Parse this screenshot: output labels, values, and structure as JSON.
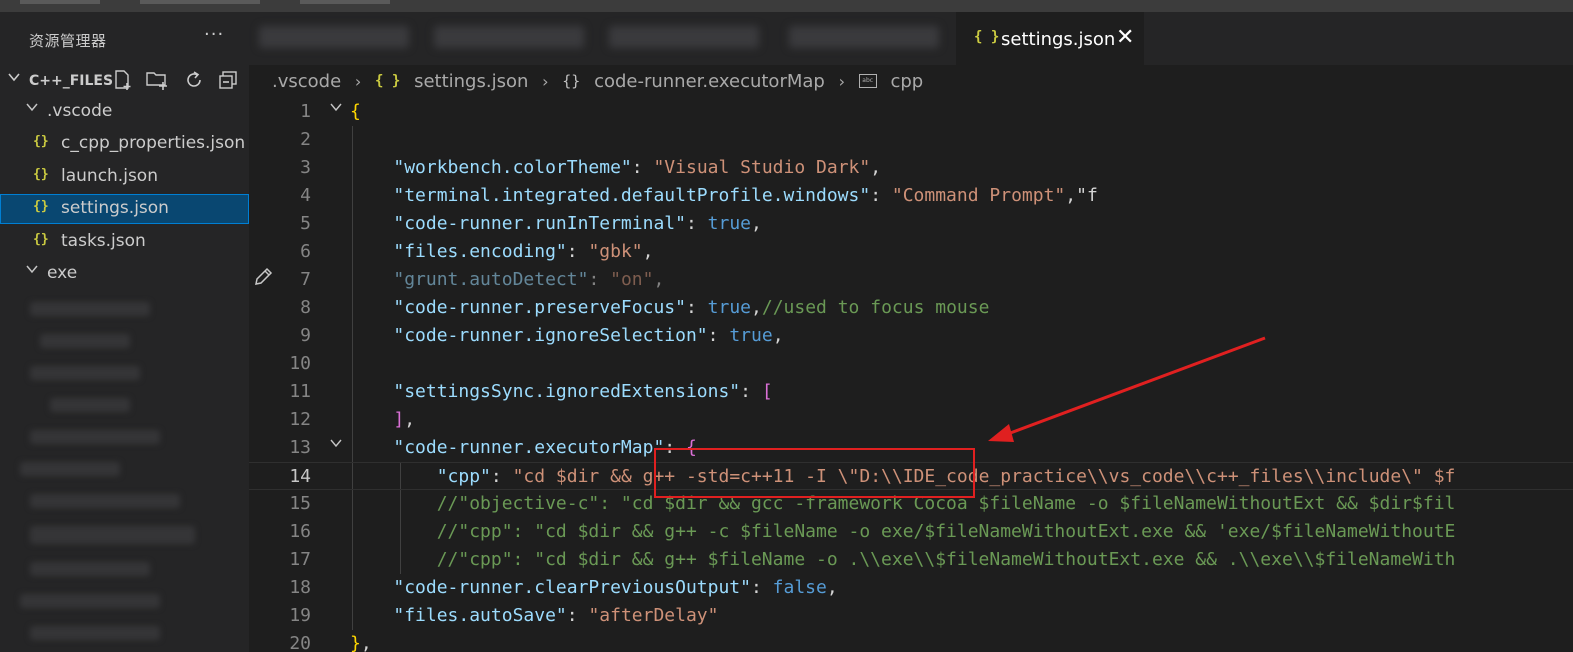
{
  "sidebar": {
    "title": "资源管理器",
    "more": "···",
    "folder_name": "C++_FILES",
    "items": [
      {
        "label": ".vscode",
        "kind": "folder"
      },
      {
        "label": "c_cpp_properties.json",
        "kind": "json"
      },
      {
        "label": "launch.json",
        "kind": "json"
      },
      {
        "label": "settings.json",
        "kind": "json",
        "selected": true
      },
      {
        "label": "tasks.json",
        "kind": "json"
      },
      {
        "label": "exe",
        "kind": "folder"
      }
    ]
  },
  "tab": {
    "icon": "{ }",
    "label": "settings.json",
    "close": "✕"
  },
  "breadcrumb": {
    "items": [
      ".vscode",
      "settings.json",
      "code-runner.executorMap",
      "cpp"
    ],
    "json_icon": "{ }",
    "obj_icon": "{}",
    "sep": "›"
  },
  "editor": {
    "line_numbers": [
      "1",
      "2",
      "3",
      "4",
      "5",
      "6",
      "7",
      "8",
      "9",
      "10",
      "11",
      "12",
      "13",
      "14",
      "15",
      "16",
      "17",
      "18",
      "19",
      "20"
    ],
    "lines": [
      [
        [
          "y",
          "{"
        ]
      ],
      [],
      [
        [
          "p",
          "    "
        ],
        [
          "k",
          "\"workbench.colorTheme\""
        ],
        [
          "p",
          ": "
        ],
        [
          "s",
          "\"Visual Studio Dark\""
        ],
        [
          "p",
          ","
        ]
      ],
      [
        [
          "p",
          "    "
        ],
        [
          "k",
          "\"terminal.integrated.defaultProfile.windows\""
        ],
        [
          "p",
          ": "
        ],
        [
          "s",
          "\"Command Prompt\""
        ],
        [
          "p",
          ",\"f"
        ]
      ],
      [
        [
          "p",
          "    "
        ],
        [
          "k",
          "\"code-runner.runInTerminal\""
        ],
        [
          "p",
          ": "
        ],
        [
          "b",
          "true"
        ],
        [
          "p",
          ","
        ]
      ],
      [
        [
          "p",
          "    "
        ],
        [
          "k",
          "\"files.encoding\""
        ],
        [
          "p",
          ": "
        ],
        [
          "s",
          "\"gbk\""
        ],
        [
          "p",
          ","
        ]
      ],
      [
        [
          "p",
          "    "
        ],
        [
          "k",
          "\"grunt.autoDetect\""
        ],
        [
          "p",
          ": "
        ],
        [
          "s",
          "\"on\""
        ],
        [
          "p",
          ","
        ]
      ],
      [
        [
          "p",
          "    "
        ],
        [
          "k",
          "\"code-runner.preserveFocus\""
        ],
        [
          "p",
          ": "
        ],
        [
          "b",
          "true"
        ],
        [
          "p",
          ","
        ],
        [
          "c",
          "//used to focus mouse"
        ]
      ],
      [
        [
          "p",
          "    "
        ],
        [
          "k",
          "\"code-runner.ignoreSelection\""
        ],
        [
          "p",
          ": "
        ],
        [
          "b",
          "true"
        ],
        [
          "p",
          ","
        ]
      ],
      [],
      [
        [
          "p",
          "    "
        ],
        [
          "k",
          "\"settingsSync.ignoredExtensions\""
        ],
        [
          "p",
          ": "
        ],
        [
          "m",
          "["
        ]
      ],
      [
        [
          "p",
          "    "
        ],
        [
          "m",
          "]"
        ],
        [
          "p",
          ","
        ]
      ],
      [
        [
          "p",
          "    "
        ],
        [
          "k",
          "\"code-runner.executorMap\""
        ],
        [
          "p",
          ": "
        ],
        [
          "m",
          "{"
        ]
      ],
      [
        [
          "p",
          "        "
        ],
        [
          "k",
          "\"cpp\""
        ],
        [
          "p",
          ": "
        ],
        [
          "s",
          "\"cd $dir && g++ -std=c++11 -I \\\"D:\\\\IDE_code_practice\\\\vs_code\\\\c++_files\\\\include\\\" $f"
        ]
      ],
      [
        [
          "p",
          "        "
        ],
        [
          "c",
          "//\"objective-c\": \"cd $dir && gcc -framework Cocoa $fileName -o $fileNameWithoutExt && $dir$fil"
        ]
      ],
      [
        [
          "p",
          "        "
        ],
        [
          "c",
          "//\"cpp\": \"cd $dir && g++ -c $fileName -o exe/$fileNameWithoutExt.exe && 'exe/$fileNameWithoutE"
        ]
      ],
      [
        [
          "p",
          "        "
        ],
        [
          "c",
          "//\"cpp\": \"cd $dir && g++ $fileName -o .\\\\exe\\\\$fileNameWithoutExt.exe && .\\\\exe\\\\$fileNameWith"
        ]
      ],
      [
        [
          "p",
          "    "
        ],
        [
          "k",
          "\"code-runner.clearPreviousOutput\""
        ],
        [
          "p",
          ": "
        ],
        [
          "b",
          "false"
        ],
        [
          "p",
          ","
        ]
      ],
      [
        [
          "p",
          "    "
        ],
        [
          "k",
          "\"files.autoSave\""
        ],
        [
          "p",
          ": "
        ],
        [
          "s",
          "\"afterDelay\""
        ]
      ],
      [
        [
          "y",
          "}"
        ],
        [
          "p",
          ","
        ]
      ]
    ]
  },
  "colors": {
    "accent": "#007fd4",
    "annotation_red": "#e02020",
    "json_icon": "#cbcb41"
  }
}
